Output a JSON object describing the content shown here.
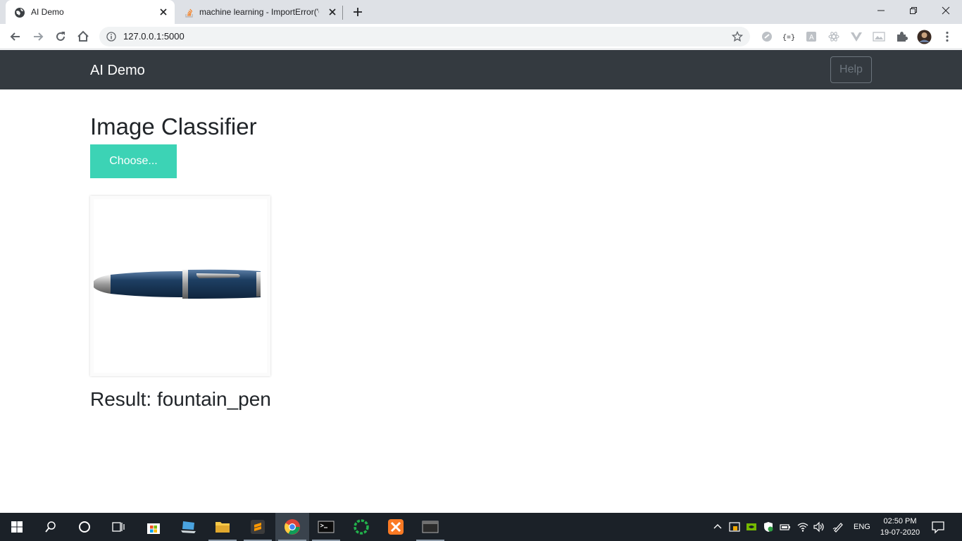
{
  "browser": {
    "tabs": [
      {
        "title": "AI Demo",
        "active": true
      },
      {
        "title": "machine learning - ImportError('C",
        "active": false
      }
    ],
    "url": "127.0.0.1:5000"
  },
  "navbar": {
    "brand": "AI Demo",
    "help_label": "Help"
  },
  "main": {
    "title": "Image Classifier",
    "choose_label": "Choose...",
    "result_prefix": "Result:",
    "result_value": "fountain_pen"
  },
  "taskbar": {
    "language": "ENG",
    "time": "02:50 PM",
    "date": "19-07-2020"
  },
  "colors": {
    "navbar_bg": "#343a40",
    "accent": "#3cd3b5",
    "pen_blue": "#1e3f63"
  }
}
